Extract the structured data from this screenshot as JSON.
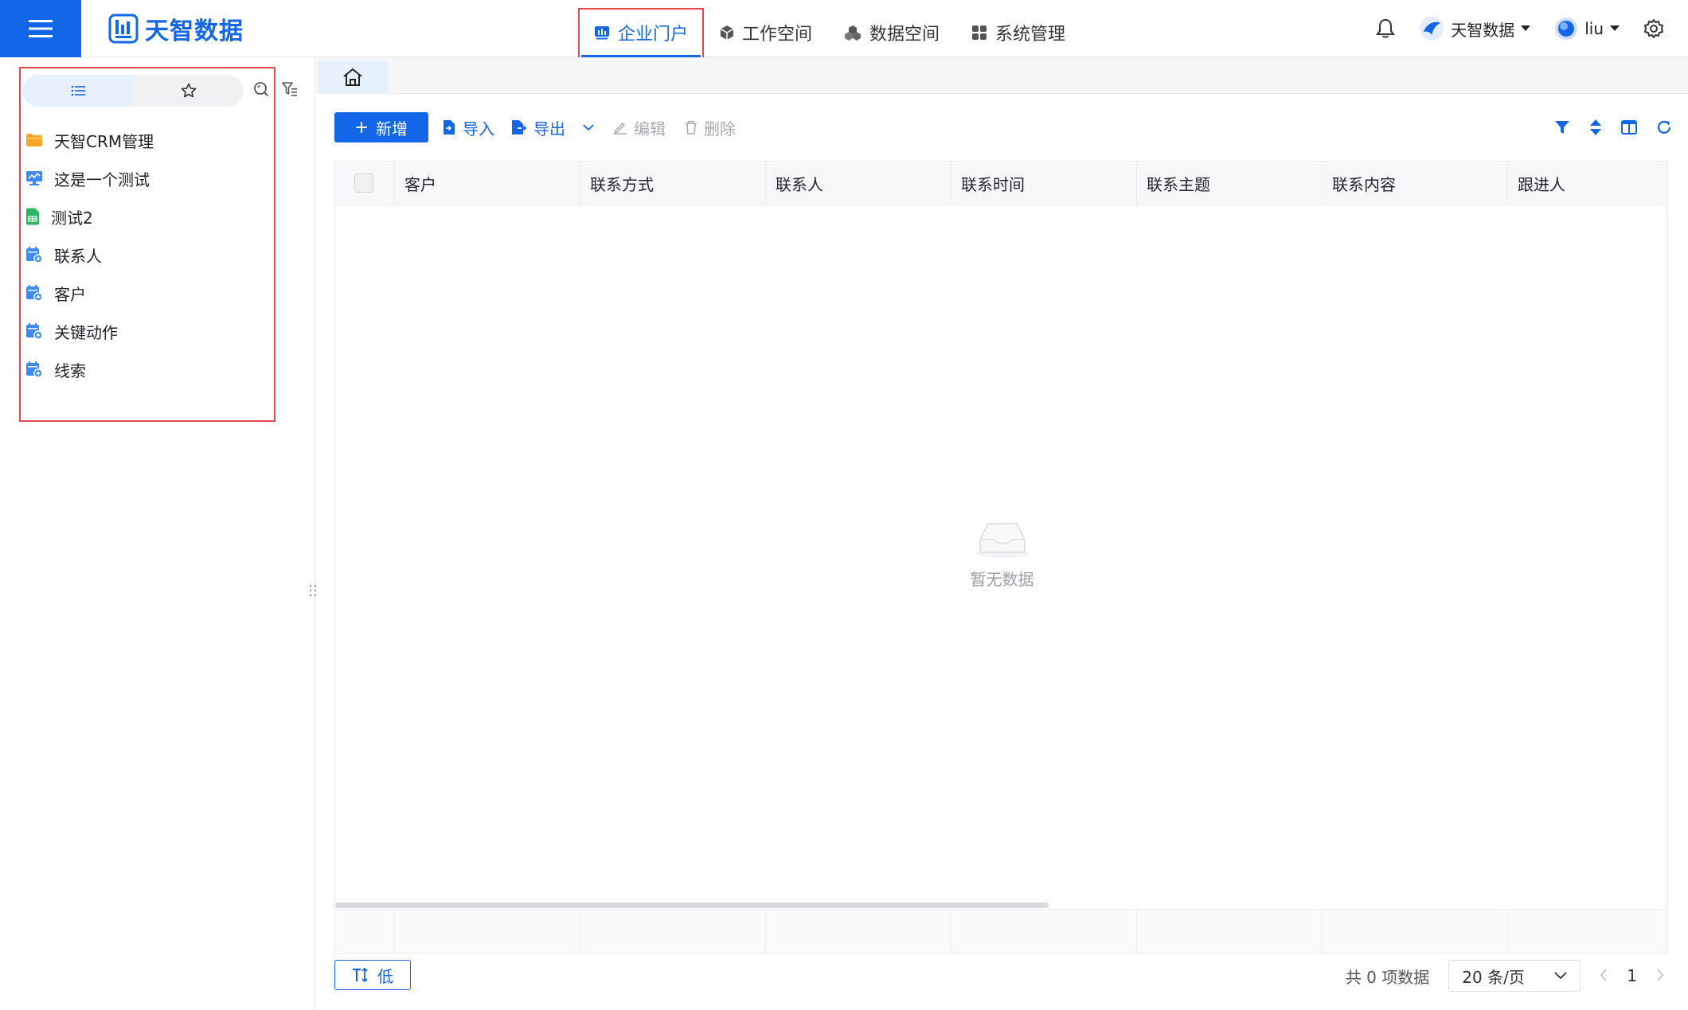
{
  "brand": {
    "name": "天智数据",
    "color": "#1466e8"
  },
  "nav": [
    {
      "label": "企业门户",
      "icon": "chart-icon",
      "active": true
    },
    {
      "label": "工作空间",
      "icon": "cube-icon",
      "active": false
    },
    {
      "label": "数据空间",
      "icon": "cubes-icon",
      "active": false
    },
    {
      "label": "系统管理",
      "icon": "grid-icon",
      "active": false
    }
  ],
  "header_tools": {
    "org_name": "天智数据",
    "user_name": "liu"
  },
  "sidebar": {
    "tabs": [
      {
        "icon": "list-icon",
        "active": true
      },
      {
        "icon": "star-icon",
        "active": false
      }
    ],
    "items": [
      {
        "label": "天智CRM管理",
        "icon": "folder-icon"
      },
      {
        "label": "这是一个测试",
        "icon": "monitor-icon"
      },
      {
        "label": "测试2",
        "icon": "sheet-icon"
      },
      {
        "label": "联系人",
        "icon": "form-icon"
      },
      {
        "label": "客户",
        "icon": "form-icon"
      },
      {
        "label": "关键动作",
        "icon": "form-icon"
      },
      {
        "label": "线索",
        "icon": "form-icon"
      }
    ]
  },
  "toolbar": {
    "add_label": "新增",
    "import_label": "导入",
    "export_label": "导出",
    "edit_label": "编辑",
    "delete_label": "删除"
  },
  "table": {
    "columns": [
      "客户",
      "联系方式",
      "联系人",
      "联系时间",
      "联系主题",
      "联系内容",
      "跟进人"
    ],
    "empty_text": "暂无数据"
  },
  "footer": {
    "priority_label": "低",
    "total_text": "共 0 项数据",
    "page_size": "20 条/页",
    "current_page": "1"
  }
}
